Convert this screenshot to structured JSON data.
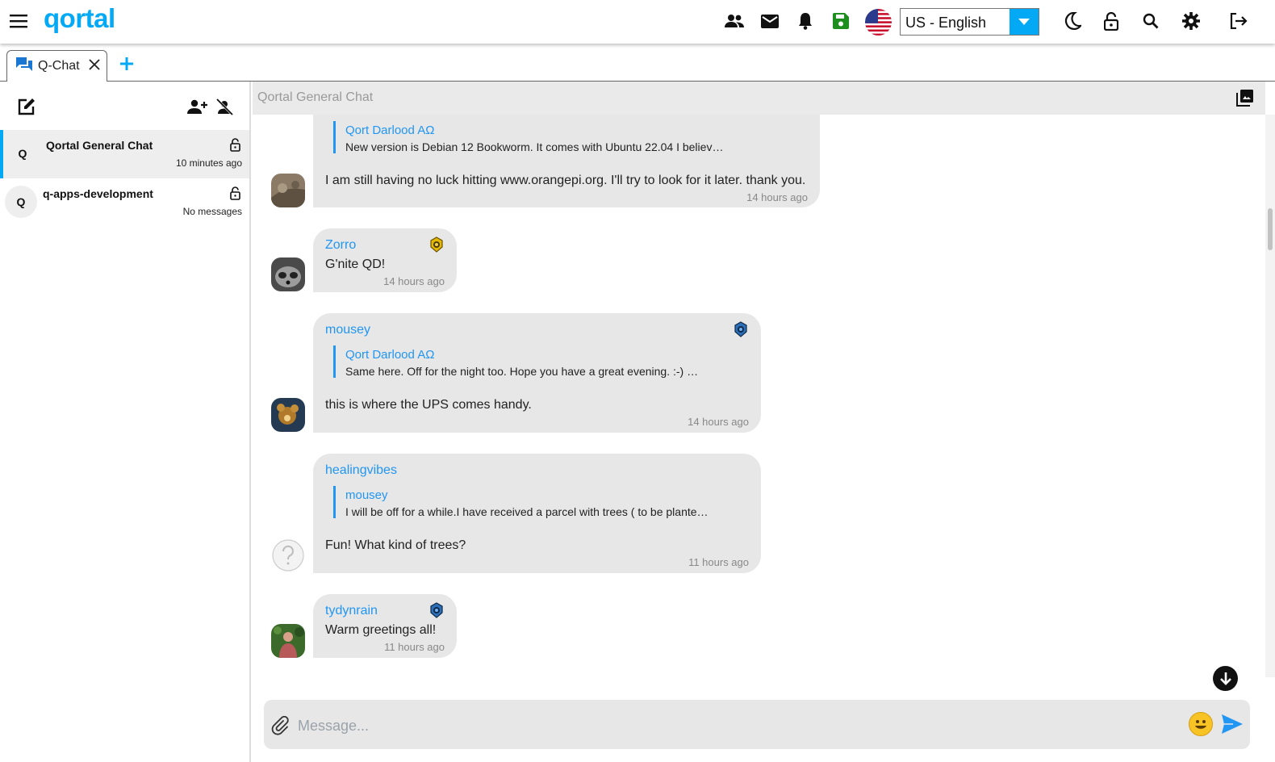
{
  "app": {
    "logo_text": "qortal",
    "accent_color": "#03a9f4",
    "language": "US - English"
  },
  "toolbar": {
    "icons": [
      "menu-icon",
      "people-icon",
      "mail-icon",
      "bell-icon",
      "save-icon",
      "us-flag-icon",
      "moon-icon",
      "lock-icon",
      "search-icon",
      "gear-icon",
      "logout-icon"
    ]
  },
  "tabs": [
    {
      "label": "Q-Chat",
      "icon": "chat-icon"
    }
  ],
  "sidebar": {
    "chats": [
      {
        "avatar_letter": "Q",
        "name": "Qortal General Chat",
        "time": "10 minutes ago",
        "locked": true,
        "active": true
      },
      {
        "avatar_letter": "Q",
        "name": "q-apps-development",
        "time": "No messages",
        "locked": true,
        "active": false
      }
    ]
  },
  "chat": {
    "title": "Qortal General Chat",
    "composer_placeholder": "Message...",
    "messages": [
      {
        "sender": "",
        "quote_name": "Qort Darlood AΩ",
        "quote_text": "New version is Debian 12 Bookworm. It comes with Ubuntu 22.04 I believ…",
        "text": "I am still having no luck hitting www.orangepi.org. I'll try to look for it later.  thank you.",
        "time": "14 hours ago"
      },
      {
        "sender": "Zorro",
        "badge": "gold-level-badge-icon",
        "text": "G'nite QD!",
        "time": "14 hours ago"
      },
      {
        "sender": "mousey",
        "badge": "blue-level-badge-icon",
        "quote_name": "Qort Darlood AΩ",
        "quote_text": "Same here. Off for the night too. Hope you have a great evening. :-)  …",
        "text": "this is where the UPS comes handy.",
        "time": "14 hours ago"
      },
      {
        "sender": "healingvibes",
        "quote_name": "mousey",
        "quote_text": "I will be off for a while.I have received a parcel with trees ( to be plante…",
        "text": "Fun! What kind of trees?",
        "time": "11 hours ago"
      },
      {
        "sender": "tydynrain",
        "badge": "blue-level-badge-icon",
        "text": "Warm greetings all!",
        "time": "11 hours ago"
      }
    ]
  }
}
